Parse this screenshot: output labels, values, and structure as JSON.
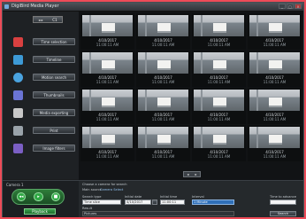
{
  "window": {
    "title": "DigiBird Media Player",
    "controls": [
      "_",
      "□",
      "×"
    ]
  },
  "sidebar": {
    "camera_selector": {
      "label": "C1",
      "arrow": "◂ ▸"
    },
    "items": [
      {
        "label": "Time selection",
        "icon": "clock-icon",
        "color": "#d94040"
      },
      {
        "label": "Timeline",
        "icon": "film-icon",
        "color": "#3d9ad6"
      },
      {
        "label": "Motion search",
        "icon": "search-icon",
        "color": "#4aa3df"
      },
      {
        "label": "Thumbnails",
        "icon": "thumbnails-icon",
        "color": "#6a74d4"
      },
      {
        "label": "Media exporting",
        "icon": "export-icon",
        "color": "#c8c8c8"
      },
      {
        "label": "Print",
        "icon": "print-icon",
        "color": "#9aa3aa"
      },
      {
        "label": "Image filters",
        "icon": "filter-icon",
        "color": "#7b5fc4"
      }
    ]
  },
  "thumbnails": [
    {
      "date": "4/10/2017",
      "time": "11:00:11 AM"
    },
    {
      "date": "4/10/2017",
      "time": "11:00:11 AM"
    },
    {
      "date": "4/10/2017",
      "time": "11:00:11 AM"
    },
    {
      "date": "4/10/2017",
      "time": "11:00:11 AM"
    },
    {
      "date": "4/10/2017",
      "time": "11:00:11 AM"
    },
    {
      "date": "4/10/2017",
      "time": "11:00:11 AM"
    },
    {
      "date": "4/10/2017",
      "time": "11:00:11 AM"
    },
    {
      "date": "4/10/2017",
      "time": "11:00:11 AM"
    },
    {
      "date": "4/10/2017",
      "time": "11:00:11 AM"
    },
    {
      "date": "4/10/2017",
      "time": "11:00:11 AM"
    },
    {
      "date": "4/10/2017",
      "time": "11:00:11 AM"
    },
    {
      "date": "4/10/2017",
      "time": "11:00:11 AM"
    },
    {
      "date": "4/10/2017",
      "time": "11:00:11 AM"
    },
    {
      "date": "4/10/2017",
      "time": "11:00:11 AM"
    },
    {
      "date": "4/10/2017",
      "time": "11:00:11 AM"
    },
    {
      "date": "4/10/2017",
      "time": "11:00:11 AM"
    }
  ],
  "pager": {
    "prev": "◂",
    "next": "▸"
  },
  "camera_panel": {
    "label": "Camera 1",
    "controls": {
      "rewind": "◂◂",
      "play": "▸",
      "stop": "■"
    },
    "mode_label": "Playback"
  },
  "search": {
    "header": "Choose a camera for search",
    "source_label": "Main source",
    "source_link": "Camera Select",
    "search_type_label": "Search type",
    "search_type_value": "Time slice",
    "initial_date_label": "Initial date",
    "initial_date_value": "4/10/2017",
    "initial_time_label": "Initial time",
    "initial_time_value": "11:00:11",
    "interval_label": "Interval",
    "interval_value": "1 Minute",
    "extra_label": "Time to advance",
    "search_button": "Search",
    "result_label": "Result",
    "result_value": "Pictures"
  }
}
